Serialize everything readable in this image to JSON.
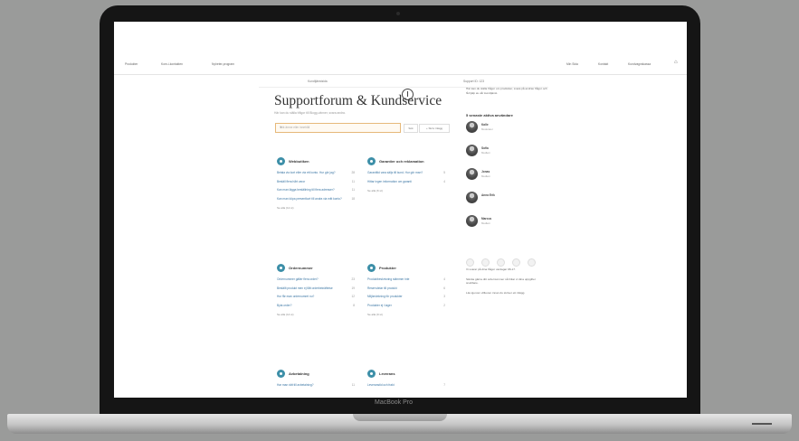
{
  "laptop": {
    "brand": "MacBook Pro"
  },
  "nav": {
    "left": [
      "Produkter",
      "Kom-i-kontakten",
      "Nyheter-program"
    ],
    "right": [
      "Min Sida",
      "Kontakt",
      "Kundvagnskassa"
    ]
  },
  "subnav": [
    "Kundtjänstsida",
    "Support ID: 123"
  ],
  "page": {
    "title": "Supportforum & Kundservice",
    "lead": "Här kan du ställa frågor till Blogg-vänner, svara andra.",
    "search_placeholder": "Sök ämne eller innehåll",
    "search_button": "Sök",
    "new_button": "+ Skriv inlägg"
  },
  "categories": [
    {
      "title": "Webbutiken",
      "questions": [
        {
          "text": "Betala via kort eller via ett konto. Hur gör jag?",
          "count": "28"
        },
        {
          "text": "Beställ flera hårt varor",
          "count": "11"
        },
        {
          "text": "Kan man lägga beställning till flera adresser?",
          "count": "11"
        },
        {
          "text": "Kan man köpa presentkort till andra via mitt konto?",
          "count": "18"
        }
      ],
      "more": "Se alla (12 st)"
    },
    {
      "title": "Garantier och reklamation",
      "questions": [
        {
          "text": "Garantitid vara säljs till kund. Hur gör man?",
          "count": "5"
        },
        {
          "text": "Hittar ingen information om garanti",
          "count": "4"
        }
      ],
      "more": "Se alla (6 st)"
    },
    {
      "title": "Ordernummer",
      "questions": [
        {
          "text": "Ordernummer gäller flera order?",
          "count": "23"
        },
        {
          "text": "Beställt produkt men ej fått orderbekräftelse",
          "count": "19"
        },
        {
          "text": "Hur får man ordernumret nu?",
          "count": "12"
        },
        {
          "text": "Byta order?",
          "count": "8"
        }
      ],
      "more": "Se alla (14 st)"
    },
    {
      "title": "Produkter",
      "questions": [
        {
          "text": "Produktbeskrivning stämmer inte",
          "count": "4"
        },
        {
          "text": "Reservdelar till produkt",
          "count": "6"
        },
        {
          "text": "Miljömärkning för produkter",
          "count": "3"
        },
        {
          "text": "Produkter ej i lager",
          "count": "2"
        }
      ],
      "more": "Se alla (9 st)"
    },
    {
      "title": "Avbetalning",
      "questions": [
        {
          "text": "Har man rätt till avbetalning?",
          "count": "11"
        }
      ],
      "more": ""
    },
    {
      "title": "Leverans",
      "questions": [
        {
          "text": "Leveranstid och frakt",
          "count": "7"
        }
      ],
      "more": ""
    }
  ],
  "sidebar": {
    "intro": "Här kan du ställa frågor om produkter, svara på andras frågor och få hjälp av vår kundtjänst.",
    "heading": "5 senaste aktiva användare",
    "users": [
      {
        "name": "Kalle",
        "role": "Moderator"
      },
      {
        "name": "Sofia",
        "role": "Medlem"
      },
      {
        "name": "Jonas",
        "role": "Medlem"
      },
      {
        "name": "Anna Erik",
        "role": ""
      },
      {
        "name": "Marcus",
        "role": "Medlem"
      }
    ],
    "paragraphs": [
      "Vi svarar på dina frågor vardagar 08-17.",
      "Skicka gärna ditt ordernummer så hittar vi dina uppgifter snabbare.",
      "Läs igenom villkoren innan du skriver ett inlägg."
    ]
  }
}
